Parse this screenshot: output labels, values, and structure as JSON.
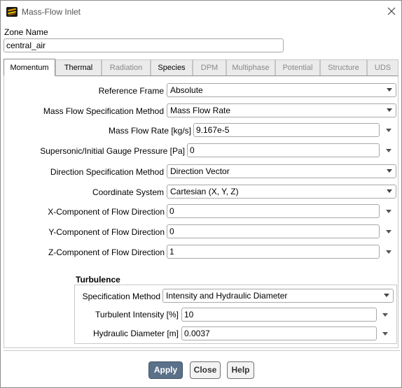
{
  "window": {
    "title": "Mass-Flow Inlet",
    "icon": "ansys-fluent-logo-icon",
    "close_icon": "close-icon"
  },
  "zone": {
    "label": "Zone Name",
    "value": "central_air"
  },
  "tabs": [
    {
      "label": "Momentum",
      "active": true,
      "enabled": true
    },
    {
      "label": "Thermal",
      "active": false,
      "enabled": true
    },
    {
      "label": "Radiation",
      "active": false,
      "enabled": false
    },
    {
      "label": "Species",
      "active": false,
      "enabled": true
    },
    {
      "label": "DPM",
      "active": false,
      "enabled": false
    },
    {
      "label": "Multiphase",
      "active": false,
      "enabled": false
    },
    {
      "label": "Potential",
      "active": false,
      "enabled": false
    },
    {
      "label": "Structure",
      "active": false,
      "enabled": false
    },
    {
      "label": "UDS",
      "active": false,
      "enabled": false
    }
  ],
  "momentum": {
    "reference_frame": {
      "label": "Reference Frame",
      "value": "Absolute"
    },
    "mass_flow_spec": {
      "label": "Mass Flow Specification Method",
      "value": "Mass Flow Rate"
    },
    "mass_flow_rate": {
      "label": "Mass Flow Rate [kg/s]",
      "value": "9.167e-5"
    },
    "gauge_pressure": {
      "label": "Supersonic/Initial Gauge Pressure [Pa]",
      "value": "0"
    },
    "direction_spec": {
      "label": "Direction Specification Method",
      "value": "Direction Vector"
    },
    "coordinate_system": {
      "label": "Coordinate System",
      "value": "Cartesian (X, Y, Z)"
    },
    "x_component": {
      "label": "X-Component of Flow Direction",
      "value": "0"
    },
    "y_component": {
      "label": "Y-Component of Flow Direction",
      "value": "0"
    },
    "z_component": {
      "label": "Z-Component of Flow Direction",
      "value": "1"
    }
  },
  "turbulence": {
    "title": "Turbulence",
    "spec_method": {
      "label": "Specification Method",
      "value": "Intensity and Hydraulic Diameter"
    },
    "intensity": {
      "label": "Turbulent Intensity [%]",
      "value": "10"
    },
    "hydraulic_diameter": {
      "label": "Hydraulic Diameter [m]",
      "value": "0.0037"
    }
  },
  "buttons": {
    "apply": "Apply",
    "close": "Close",
    "help": "Help"
  },
  "colors": {
    "primary_button": "#5b7189",
    "border": "#a8a8a8"
  }
}
